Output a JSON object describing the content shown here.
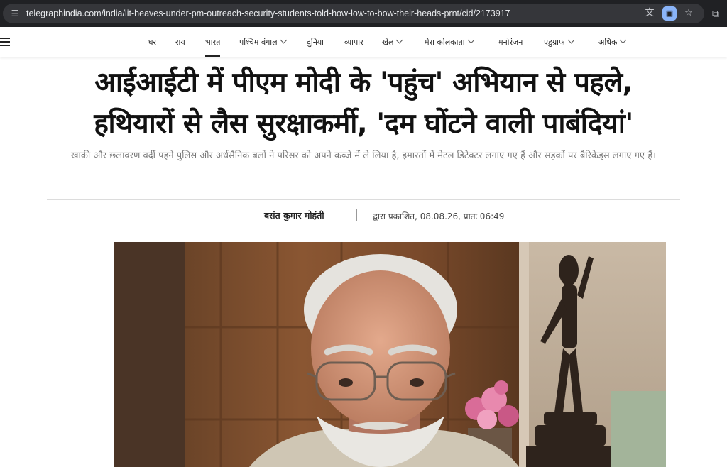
{
  "browser": {
    "url": "telegraphindia.com/india/iit-heaves-under-pm-outreach-security-students-told-how-low-to-bow-their-heads-prnt/cid/2173917",
    "icons": [
      "site-info-icon",
      "translate-icon",
      "cast-icon",
      "bookmark-star-icon",
      "extensions-icon"
    ]
  },
  "nav": {
    "items": [
      {
        "label": "घर"
      },
      {
        "label": "राय"
      },
      {
        "label": "भारत"
      },
      {
        "label": "पश्चिम बंगाल"
      },
      {
        "label": "दुनिया"
      },
      {
        "label": "व्यापार"
      },
      {
        "label": "खेल"
      },
      {
        "label": "मेरा कोलकाता"
      },
      {
        "label": "मनोरंजन"
      },
      {
        "label": "एडुग्राफ"
      },
      {
        "label": "अधिक"
      }
    ],
    "active": "भारत"
  },
  "article": {
    "headline_line1": "आईआईटी में पीएम मोदी के 'पहुंच' अभियान से पहले,",
    "headline_line2": "हथियारों से लैस सुरक्षाकर्मी, 'दम घोंटने वाली पाबंदियां'",
    "subheadline": "खाकी और छलावरण वर्दी पहने पुलिस और अर्धसैनिक बलों ने परिसर को अपने कब्जे में ले लिया है, इमारतों में मेटल डिटेक्टर लगाए गए हैं और सड़कों पर बैरिकेड्स लगाए गए हैं।",
    "author": "बसंत कुमार मोहंती",
    "published": "द्वारा प्रकाशित, 08.08.26, प्रातः 06:49"
  },
  "colors": {
    "browser_bg": "#202124",
    "url_box_bg": "#35363a",
    "accent_blue": "#8ab4f8",
    "headline": "#111111",
    "subheadline": "#777777"
  }
}
